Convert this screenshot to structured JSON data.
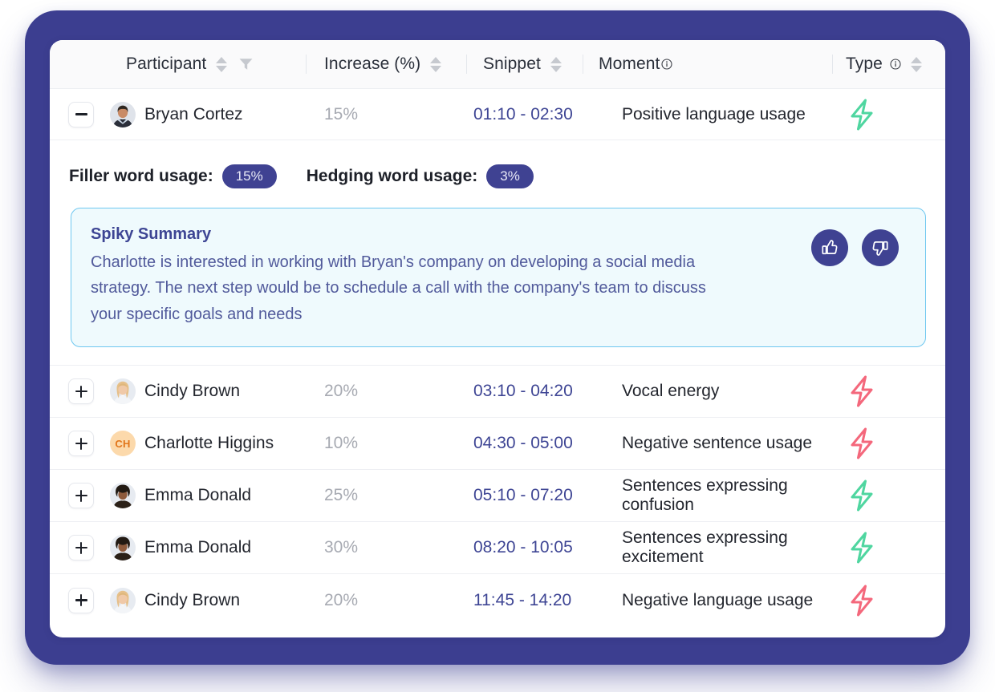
{
  "theme": {
    "frame_color": "#3c3e90",
    "accent_indigo": "#3f4292",
    "summary_border": "#6ec7f0",
    "summary_bg": "#effafd",
    "bolt_positive": "#4fd6a0",
    "bolt_negative": "#f4687c"
  },
  "table": {
    "columns": [
      {
        "label": "Participant",
        "sortable": true,
        "filterable": true,
        "info": false
      },
      {
        "label": "Increase (%)",
        "sortable": true,
        "filterable": false,
        "info": false
      },
      {
        "label": "Snippet",
        "sortable": true,
        "filterable": false,
        "info": false
      },
      {
        "label": "Moment",
        "sortable": false,
        "filterable": false,
        "info": true
      },
      {
        "label": "Type",
        "sortable": true,
        "filterable": false,
        "info": true
      }
    ],
    "rows": [
      {
        "participant": "Bryan Cortez",
        "avatar": "photo-male",
        "increase": "15%",
        "snippet": "01:10 - 02:30",
        "moment": "Positive language usage",
        "type": "positive",
        "expanded": true,
        "toggle": "minus"
      },
      {
        "participant": "Cindy Brown",
        "avatar": "photo-female-blonde",
        "increase": "20%",
        "snippet": "03:10 - 04:20",
        "moment": "Vocal energy",
        "type": "negative",
        "expanded": false,
        "toggle": "plus"
      },
      {
        "participant": "Charlotte Higgins",
        "avatar": "initials",
        "initials": "CH",
        "increase": "10%",
        "snippet": "04:30 - 05:00",
        "moment": "Negative sentence usage",
        "type": "negative",
        "expanded": false,
        "toggle": "plus"
      },
      {
        "participant": "Emma Donald",
        "avatar": "photo-female-curly",
        "increase": "25%",
        "snippet": "05:10 - 07:20",
        "moment": "Sentences expressing confusion",
        "type": "positive",
        "expanded": false,
        "toggle": "plus"
      },
      {
        "participant": "Emma Donald",
        "avatar": "photo-female-curly",
        "increase": "30%",
        "snippet": "08:20 - 10:05",
        "moment": "Sentences expressing excitement",
        "type": "positive",
        "expanded": false,
        "toggle": "plus"
      },
      {
        "participant": "Cindy Brown",
        "avatar": "photo-female-blonde",
        "increase": "20%",
        "snippet": "11:45 - 14:20",
        "moment": "Negative language usage",
        "type": "negative",
        "expanded": false,
        "toggle": "plus"
      }
    ]
  },
  "detail": {
    "filler_label": "Filler word usage:",
    "filler_value": "15%",
    "hedging_label": "Hedging word usage:",
    "hedging_value": "3%",
    "summary_title": "Spiky Summary",
    "summary_text": "Charlotte is interested in working with Bryan's company on developing a social media strategy. The next step would be to schedule a call with the company's team to discuss your specific goals and needs",
    "thumbs_up_icon": "thumbs-up-icon",
    "thumbs_down_icon": "thumbs-down-icon"
  }
}
